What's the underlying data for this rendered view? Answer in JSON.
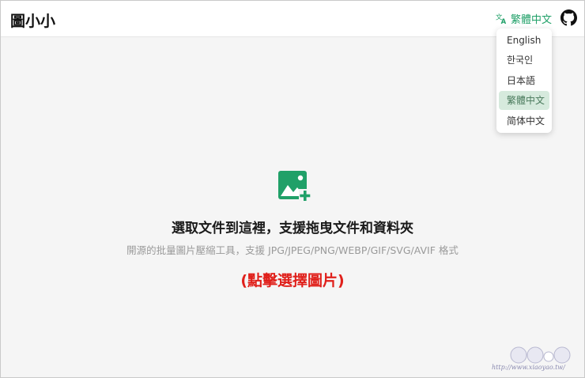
{
  "app": {
    "title": "圖小小"
  },
  "header": {
    "language_button": "繁體中文",
    "language_icon": "translate-icon",
    "github_icon": "github-icon"
  },
  "language_menu": {
    "items": [
      {
        "label": "English"
      },
      {
        "label": "한국인"
      },
      {
        "label": "日本語"
      },
      {
        "label": "繁體中文",
        "selected": true
      },
      {
        "label": "简体中文"
      }
    ]
  },
  "dropzone": {
    "icon": "image-add-icon",
    "title": "選取文件到這裡，支援拖曳文件和資料夾",
    "subtitle": "開源的批量圖片壓縮工具，支援 JPG/JPEG/PNG/WEBP/GIF/SVG/AVIF 格式",
    "cta": "(點擊選擇圖片)"
  },
  "watermark": {
    "text": "http://www.xiaoyao.tw/"
  },
  "colors": {
    "accent": "#20a068",
    "cta": "#e0201b",
    "background": "#f5f5f5"
  }
}
